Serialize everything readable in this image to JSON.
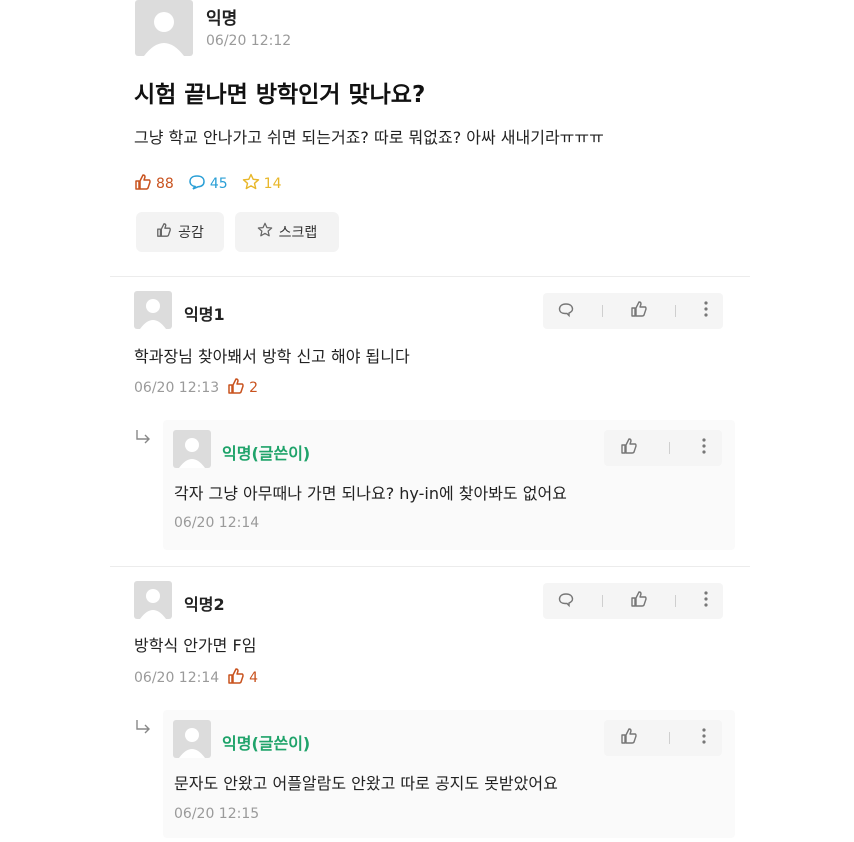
{
  "post": {
    "author": "익명",
    "time": "06/20 12:12",
    "title": "시험 끝나면 방학인거 맞나요?",
    "body": "그냥 학교 안나가고 쉬면 되는거죠? 따로 뭐없죠? 아싸 새내기라ㅠㅠㅠ",
    "likes": "88",
    "comments": "45",
    "scraps": "14",
    "like_button": "공감",
    "scrap_button": "스크랩"
  },
  "comments": [
    {
      "author": "익명1",
      "text": "학과장님 찾아봬서 방학 신고 해야 됩니다",
      "time": "06/20 12:13",
      "likes": "2",
      "reply": {
        "author": "익명(글쓴이)",
        "text": "각자 그냥 아무때나 가면 되나요? hy-in에 찾아봐도 없어요",
        "time": "06/20 12:14"
      }
    },
    {
      "author": "익명2",
      "text": "방학식 안가면 F임",
      "time": "06/20 12:14",
      "likes": "4",
      "reply": {
        "author": "익명(글쓴이)",
        "text": "문자도 안왔고 어플알람도 안왔고 따로 공지도 못받았어요",
        "time": "06/20 12:15"
      }
    }
  ],
  "colors": {
    "like": "#c9531f",
    "comment": "#2a9fd6",
    "scrap": "#e8b72a",
    "writer": "#1fa36a"
  }
}
